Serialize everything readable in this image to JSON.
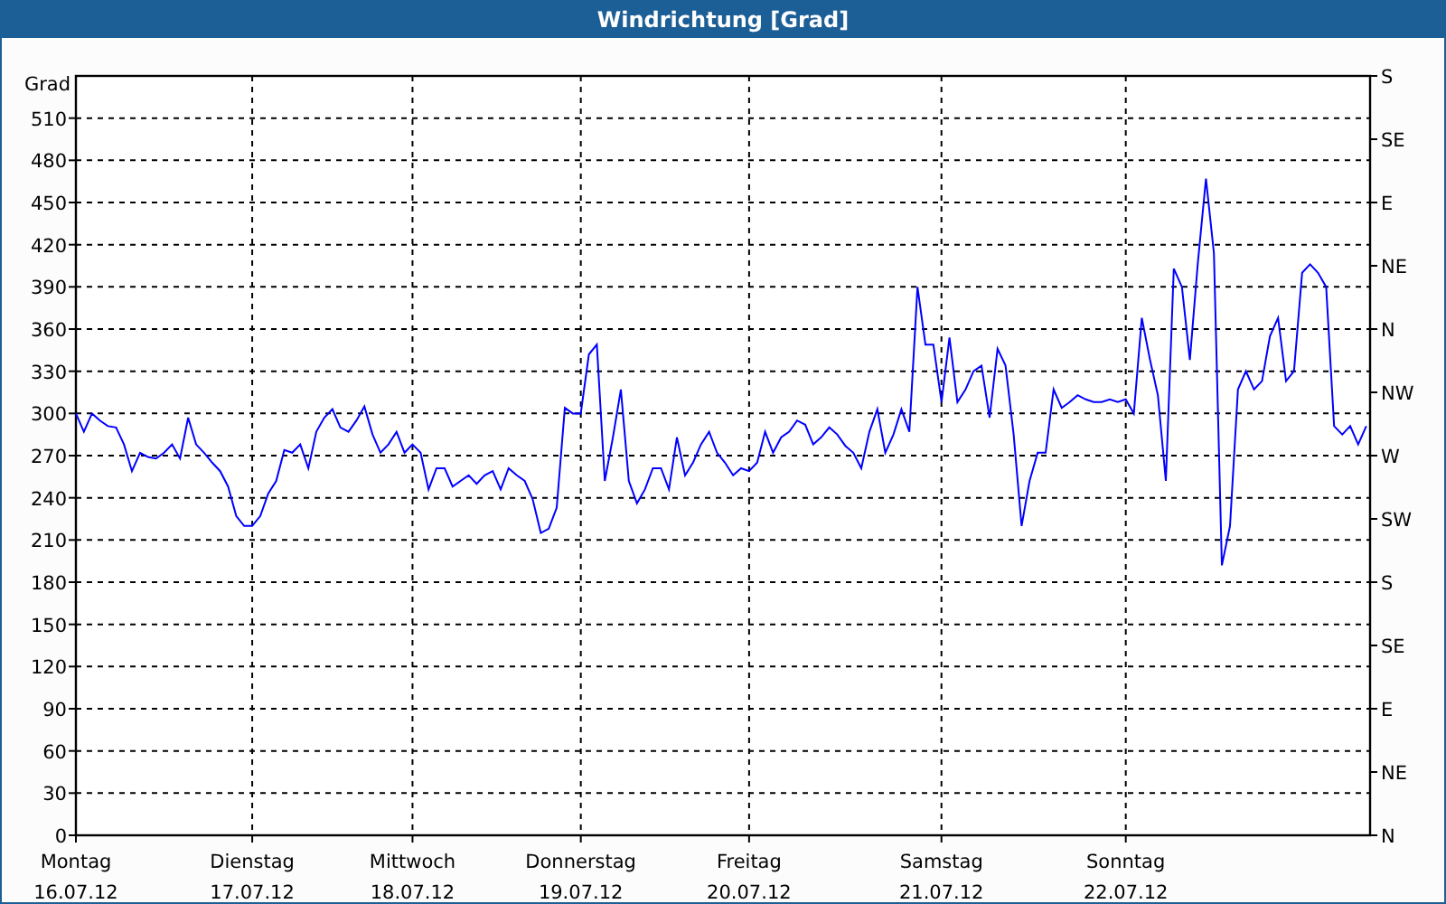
{
  "window": {
    "title": "Windrichtung [Grad]"
  },
  "chart": {
    "compass_labels": [
      "S",
      "SE",
      "E",
      "NE",
      "N",
      "NW",
      "W",
      "SW",
      "S",
      "SE",
      "E",
      "NE",
      "N"
    ],
    "chart_data": {
      "type": "line",
      "grid": true,
      "ylabel": "Grad",
      "ylim": [
        0,
        540
      ],
      "yticks": [
        0,
        30,
        60,
        90,
        120,
        150,
        180,
        210,
        240,
        270,
        300,
        330,
        360,
        390,
        420,
        450,
        480,
        510
      ],
      "categories": [
        "Montag\n16.07.12",
        null,
        null,
        null,
        null,
        null,
        null,
        null,
        null,
        null,
        null,
        null,
        null,
        null,
        null,
        null,
        null,
        null,
        null,
        null,
        null,
        null,
        "Dienstag\n17.07.12",
        null,
        null,
        null,
        null,
        null,
        null,
        null,
        null,
        null,
        null,
        null,
        null,
        null,
        null,
        null,
        null,
        null,
        null,
        null,
        "Mittwoch\n18.07.12",
        null,
        null,
        null,
        null,
        null,
        null,
        null,
        null,
        null,
        null,
        null,
        null,
        null,
        null,
        null,
        null,
        null,
        null,
        null,
        null,
        "Donnerstag\n19.07.12",
        null,
        null,
        null,
        null,
        null,
        null,
        null,
        null,
        null,
        null,
        null,
        null,
        null,
        null,
        null,
        null,
        null,
        null,
        null,
        null,
        "Freitag\n20.07.12",
        null,
        null,
        null,
        null,
        null,
        null,
        null,
        null,
        null,
        null,
        null,
        null,
        null,
        null,
        null,
        null,
        null,
        null,
        null,
        null,
        null,
        null,
        null,
        "Samstag\n21.07.12",
        null,
        null,
        null,
        null,
        null,
        null,
        null,
        null,
        null,
        null,
        null,
        null,
        null,
        null,
        null,
        null,
        null,
        null,
        null,
        null,
        null,
        null,
        "Sonntag\n22.07.12",
        null,
        null,
        null,
        null,
        null,
        null,
        null,
        null,
        null,
        null,
        null,
        null,
        null,
        null,
        null,
        null,
        null,
        null,
        null,
        null,
        null,
        null,
        null,
        null,
        null,
        null,
        null,
        null,
        null,
        null
      ],
      "series": [
        {
          "color": "#0000ff",
          "values": [
            300,
            287,
            300,
            295,
            291,
            290,
            278,
            259,
            272,
            269,
            268,
            272,
            278,
            268,
            297,
            278,
            272,
            265,
            259,
            248,
            227,
            220,
            220,
            227,
            243,
            252,
            274,
            272,
            278,
            261,
            287,
            297,
            303,
            290,
            287,
            295,
            305,
            285,
            272,
            278,
            287,
            272,
            278,
            272,
            246,
            261,
            261,
            248,
            252,
            256,
            250,
            256,
            259,
            246,
            261,
            256,
            252,
            239,
            215,
            218,
            233,
            304,
            300,
            300,
            342,
            349,
            252,
            283,
            317,
            252,
            236,
            246,
            261,
            261,
            246,
            283,
            256,
            265,
            278,
            287,
            272,
            265,
            256,
            261,
            259,
            265,
            287,
            272,
            283,
            287,
            295,
            292,
            278,
            283,
            290,
            285,
            277,
            272,
            261,
            287,
            303,
            272,
            285,
            303,
            287,
            390,
            349,
            349,
            308,
            354,
            308,
            317,
            330,
            334,
            297,
            346,
            334,
            285,
            220,
            252,
            272,
            272,
            317,
            304,
            308,
            313,
            310,
            308,
            308,
            310,
            308,
            310,
            300,
            368,
            339,
            313,
            252,
            403,
            390,
            338,
            407,
            467,
            414,
            192,
            220,
            317,
            330,
            317,
            323,
            355,
            368,
            323,
            330,
            400,
            406,
            400,
            390,
            291,
            285,
            291,
            278,
            291
          ]
        }
      ]
    }
  }
}
